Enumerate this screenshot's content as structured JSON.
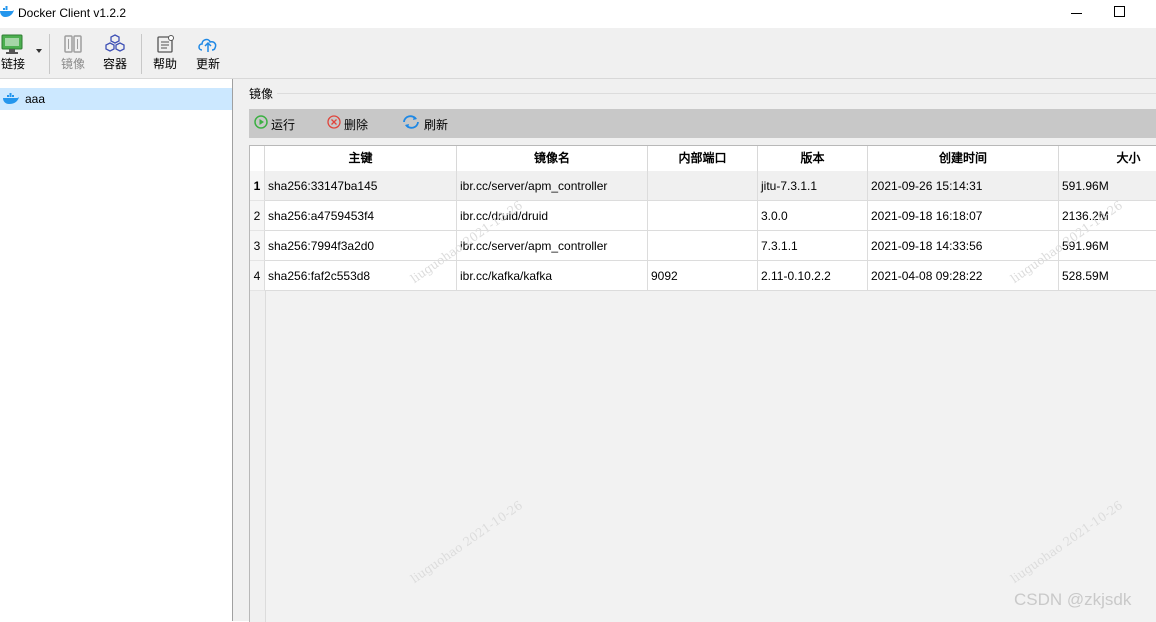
{
  "window": {
    "title": "Docker Client v1.2.2"
  },
  "toolbar": {
    "connect": "链接",
    "images": "镜像",
    "containers": "容器",
    "help": "帮助",
    "update": "更新"
  },
  "sidebar": {
    "items": [
      {
        "label": "aaa"
      }
    ]
  },
  "panel": {
    "title": "镜像",
    "actions": {
      "run": "运行",
      "delete": "删除",
      "refresh": "刷新"
    }
  },
  "table": {
    "columns": [
      "主键",
      "镜像名",
      "内部端口",
      "版本",
      "创建时间",
      "大小"
    ],
    "rows": [
      {
        "num": "1",
        "id": "sha256:33147ba145",
        "name": "ibr.cc/server/apm_controller",
        "port": "",
        "version": "jitu-7.3.1.1",
        "created": "2021-09-26 15:14:31",
        "size": "591.96M"
      },
      {
        "num": "2",
        "id": "sha256:a4759453f4",
        "name": "ibr.cc/druid/druid",
        "port": "",
        "version": "3.0.0",
        "created": "2021-09-18 16:18:07",
        "size": "2136.2M"
      },
      {
        "num": "3",
        "id": "sha256:7994f3a2d0",
        "name": "ibr.cc/server/apm_controller",
        "port": "",
        "version": "7.3.1.1",
        "created": "2021-09-18 14:33:56",
        "size": "591.96M"
      },
      {
        "num": "4",
        "id": "sha256:faf2c553d8",
        "name": "ibr.cc/kafka/kafka",
        "port": "9092",
        "version": "2.11-0.10.2.2",
        "created": "2021-04-08 09:28:22",
        "size": "528.59M"
      }
    ]
  },
  "watermark": {
    "text": "liuguohao 2021-10-26",
    "credit": "CSDN @zkjsdk"
  },
  "colors": {
    "selection": "#cce8ff",
    "actionbar": "#c8c8c8",
    "run_green": "#3cb043",
    "delete_red": "#e0443b",
    "refresh_blue": "#1e88e5"
  }
}
